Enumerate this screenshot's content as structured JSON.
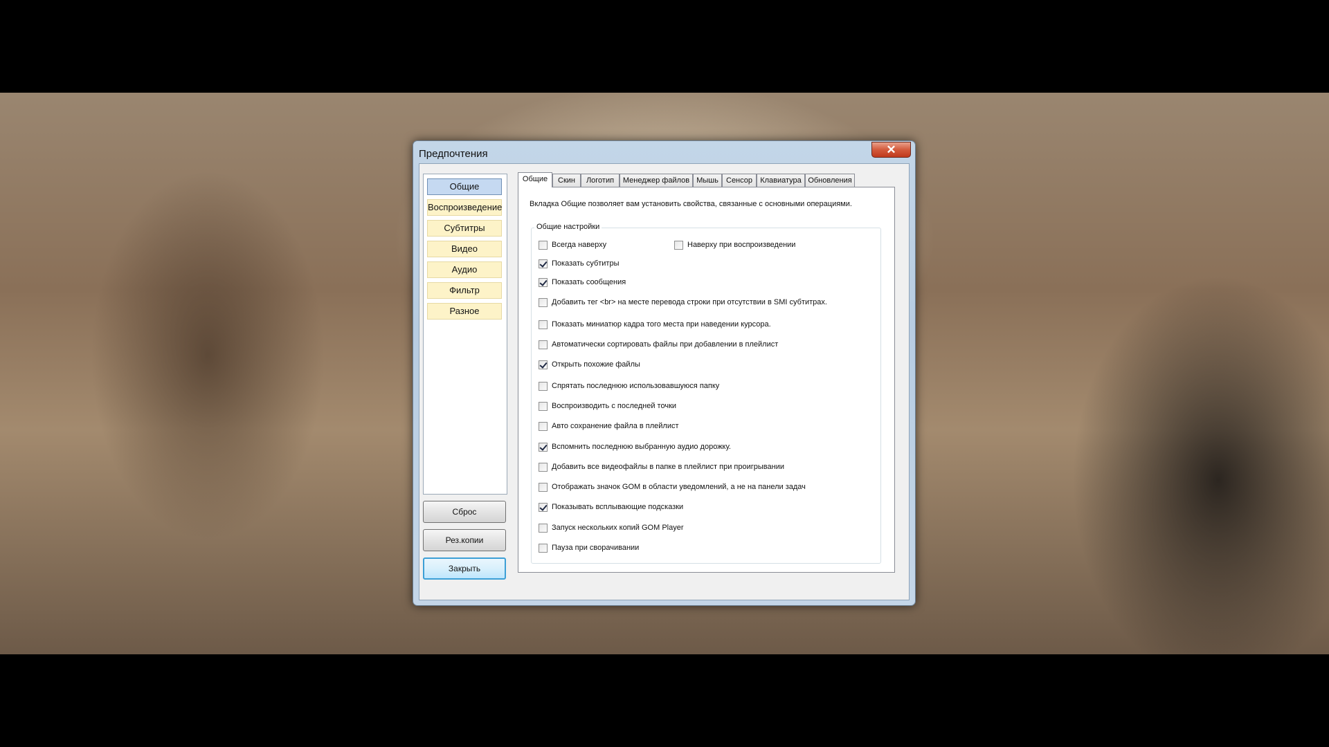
{
  "dialog": {
    "title": "Предпочтения",
    "close_glyph": "✕"
  },
  "categories": [
    {
      "label": "Общие",
      "active": true
    },
    {
      "label": "Воспроизведение",
      "active": false
    },
    {
      "label": "Субтитры",
      "active": false
    },
    {
      "label": "Видео",
      "active": false
    },
    {
      "label": "Аудио",
      "active": false
    },
    {
      "label": "Фильтр",
      "active": false
    },
    {
      "label": "Разное",
      "active": false
    }
  ],
  "buttons": {
    "reset": "Сброс",
    "backup": "Рез.копии",
    "close": "Закрыть"
  },
  "tabs": [
    {
      "label": "Общие",
      "active": true
    },
    {
      "label": "Скин"
    },
    {
      "label": "Логотип"
    },
    {
      "label": "Менеджер файлов"
    },
    {
      "label": "Мышь"
    },
    {
      "label": "Сенсор"
    },
    {
      "label": "Клавиатура"
    },
    {
      "label": "Обновления"
    }
  ],
  "panel": {
    "description": "Вкладка Общие позволяет вам установить свойства, связанные с основными операциями.",
    "group_title": "Общие настройки",
    "options": [
      {
        "label": "Всегда наверху",
        "checked": false
      },
      {
        "label": "Наверху при воспроизведении",
        "checked": false
      },
      {
        "label": "Показать субтитры",
        "checked": true
      },
      {
        "label": "Показать сообщения",
        "checked": true
      },
      {
        "label": "Добавить тег <br> на месте перевода строки при отсутствии в SMI субтитрах.",
        "checked": false
      },
      {
        "label": "Показать миниатюр кадра того места при наведении курсора.",
        "checked": false
      },
      {
        "label": "Автоматически сортировать файлы при добавлении в плейлист",
        "checked": false
      },
      {
        "label": "Открыть похожие файлы",
        "checked": true
      },
      {
        "label": "Спрятать последнюю использовавшуюся папку",
        "checked": false
      },
      {
        "label": "Воспроизводить с последней точки",
        "checked": false
      },
      {
        "label": "Авто сохранение файла в плейлист",
        "checked": false
      },
      {
        "label": "Вспомнить последнюю выбранную аудио дорожку.",
        "checked": true
      },
      {
        "label": "Добавить все видеофайлы в папке в плейлист при проигрывании",
        "checked": false
      },
      {
        "label": "Отображать значок GOM в области уведомлений, а не на панели задач",
        "checked": false
      },
      {
        "label": "Показывать всплывающие подсказки",
        "checked": true
      },
      {
        "label": "Запуск нескольких копий GOM Player",
        "checked": false
      },
      {
        "label": "Пауза при сворачивании",
        "checked": false
      }
    ]
  }
}
